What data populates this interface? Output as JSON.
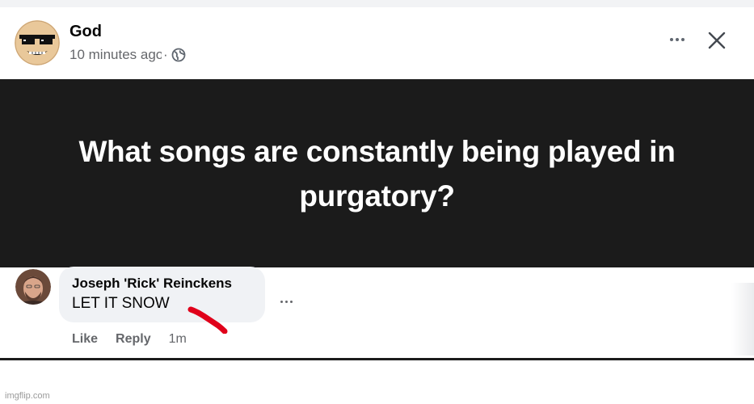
{
  "post": {
    "author": "God",
    "timestamp": "10 minutes ago",
    "separator": "·",
    "audience_icon": "globe-icon",
    "more_icon": "more-horizontal-icon",
    "close_icon": "close-icon",
    "banner_text": "What songs are constantly being played in purgatory?"
  },
  "comment": {
    "author": "Joseph 'Rick' Reinckens",
    "text": "LET IT SNOW",
    "actions": {
      "like": "Like",
      "reply": "Reply",
      "time": "1m"
    },
    "more_icon": "more-horizontal-icon"
  },
  "watermark": "imgflip.com",
  "colors": {
    "banner_bg": "#1b1b1b",
    "bubble_bg": "#f0f2f5",
    "meta_text": "#65676b",
    "scribble": "#e0001a"
  }
}
